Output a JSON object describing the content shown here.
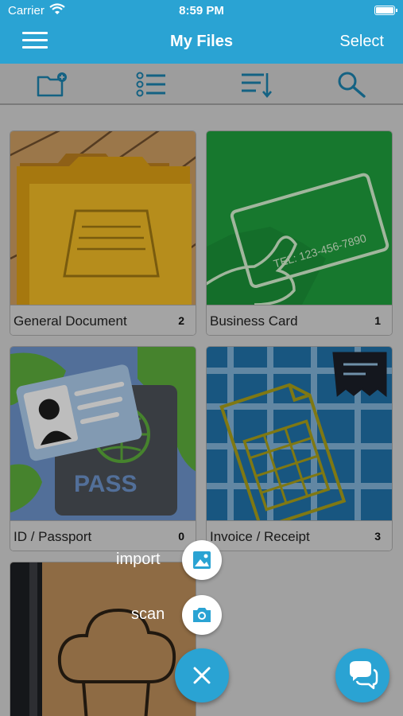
{
  "status": {
    "carrier": "Carrier",
    "time": "8:59 PM"
  },
  "navbar": {
    "title": "My Files",
    "select_label": "Select"
  },
  "toolbar": {
    "icons": [
      "new-folder-icon",
      "list-icon",
      "sort-icon",
      "search-icon"
    ]
  },
  "folders": [
    {
      "name": "General Document",
      "count": "2"
    },
    {
      "name": "Business Card",
      "count": "1"
    },
    {
      "name": "ID / Passport",
      "count": "0"
    },
    {
      "name": "Invoice / Receipt",
      "count": "3"
    }
  ],
  "business_card_art": {
    "tel": "TEL: 123-456-7890"
  },
  "passport_art": {
    "word": "PASS"
  },
  "fab": {
    "import_label": "import",
    "scan_label": "scan"
  },
  "colors": {
    "accent": "#2aa3d3",
    "card_green": "#1e9a3c",
    "card_blue": "#1f6fa5"
  }
}
